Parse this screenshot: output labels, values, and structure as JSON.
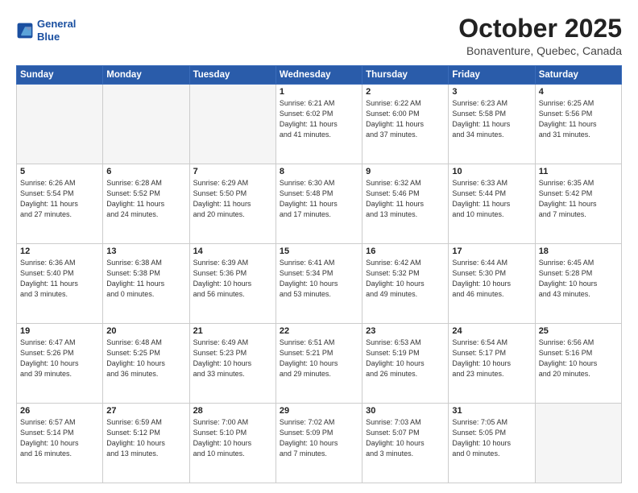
{
  "header": {
    "logo_line1": "General",
    "logo_line2": "Blue",
    "month_title": "October 2025",
    "location": "Bonaventure, Quebec, Canada"
  },
  "weekdays": [
    "Sunday",
    "Monday",
    "Tuesday",
    "Wednesday",
    "Thursday",
    "Friday",
    "Saturday"
  ],
  "weeks": [
    [
      {
        "day": "",
        "info": "",
        "empty": true
      },
      {
        "day": "",
        "info": "",
        "empty": true
      },
      {
        "day": "",
        "info": "",
        "empty": true
      },
      {
        "day": "1",
        "info": "Sunrise: 6:21 AM\nSunset: 6:02 PM\nDaylight: 11 hours\nand 41 minutes."
      },
      {
        "day": "2",
        "info": "Sunrise: 6:22 AM\nSunset: 6:00 PM\nDaylight: 11 hours\nand 37 minutes."
      },
      {
        "day": "3",
        "info": "Sunrise: 6:23 AM\nSunset: 5:58 PM\nDaylight: 11 hours\nand 34 minutes."
      },
      {
        "day": "4",
        "info": "Sunrise: 6:25 AM\nSunset: 5:56 PM\nDaylight: 11 hours\nand 31 minutes."
      }
    ],
    [
      {
        "day": "5",
        "info": "Sunrise: 6:26 AM\nSunset: 5:54 PM\nDaylight: 11 hours\nand 27 minutes."
      },
      {
        "day": "6",
        "info": "Sunrise: 6:28 AM\nSunset: 5:52 PM\nDaylight: 11 hours\nand 24 minutes."
      },
      {
        "day": "7",
        "info": "Sunrise: 6:29 AM\nSunset: 5:50 PM\nDaylight: 11 hours\nand 20 minutes."
      },
      {
        "day": "8",
        "info": "Sunrise: 6:30 AM\nSunset: 5:48 PM\nDaylight: 11 hours\nand 17 minutes."
      },
      {
        "day": "9",
        "info": "Sunrise: 6:32 AM\nSunset: 5:46 PM\nDaylight: 11 hours\nand 13 minutes."
      },
      {
        "day": "10",
        "info": "Sunrise: 6:33 AM\nSunset: 5:44 PM\nDaylight: 11 hours\nand 10 minutes."
      },
      {
        "day": "11",
        "info": "Sunrise: 6:35 AM\nSunset: 5:42 PM\nDaylight: 11 hours\nand 7 minutes."
      }
    ],
    [
      {
        "day": "12",
        "info": "Sunrise: 6:36 AM\nSunset: 5:40 PM\nDaylight: 11 hours\nand 3 minutes."
      },
      {
        "day": "13",
        "info": "Sunrise: 6:38 AM\nSunset: 5:38 PM\nDaylight: 11 hours\nand 0 minutes."
      },
      {
        "day": "14",
        "info": "Sunrise: 6:39 AM\nSunset: 5:36 PM\nDaylight: 10 hours\nand 56 minutes."
      },
      {
        "day": "15",
        "info": "Sunrise: 6:41 AM\nSunset: 5:34 PM\nDaylight: 10 hours\nand 53 minutes."
      },
      {
        "day": "16",
        "info": "Sunrise: 6:42 AM\nSunset: 5:32 PM\nDaylight: 10 hours\nand 49 minutes."
      },
      {
        "day": "17",
        "info": "Sunrise: 6:44 AM\nSunset: 5:30 PM\nDaylight: 10 hours\nand 46 minutes."
      },
      {
        "day": "18",
        "info": "Sunrise: 6:45 AM\nSunset: 5:28 PM\nDaylight: 10 hours\nand 43 minutes."
      }
    ],
    [
      {
        "day": "19",
        "info": "Sunrise: 6:47 AM\nSunset: 5:26 PM\nDaylight: 10 hours\nand 39 minutes."
      },
      {
        "day": "20",
        "info": "Sunrise: 6:48 AM\nSunset: 5:25 PM\nDaylight: 10 hours\nand 36 minutes."
      },
      {
        "day": "21",
        "info": "Sunrise: 6:49 AM\nSunset: 5:23 PM\nDaylight: 10 hours\nand 33 minutes."
      },
      {
        "day": "22",
        "info": "Sunrise: 6:51 AM\nSunset: 5:21 PM\nDaylight: 10 hours\nand 29 minutes."
      },
      {
        "day": "23",
        "info": "Sunrise: 6:53 AM\nSunset: 5:19 PM\nDaylight: 10 hours\nand 26 minutes."
      },
      {
        "day": "24",
        "info": "Sunrise: 6:54 AM\nSunset: 5:17 PM\nDaylight: 10 hours\nand 23 minutes."
      },
      {
        "day": "25",
        "info": "Sunrise: 6:56 AM\nSunset: 5:16 PM\nDaylight: 10 hours\nand 20 minutes."
      }
    ],
    [
      {
        "day": "26",
        "info": "Sunrise: 6:57 AM\nSunset: 5:14 PM\nDaylight: 10 hours\nand 16 minutes."
      },
      {
        "day": "27",
        "info": "Sunrise: 6:59 AM\nSunset: 5:12 PM\nDaylight: 10 hours\nand 13 minutes."
      },
      {
        "day": "28",
        "info": "Sunrise: 7:00 AM\nSunset: 5:10 PM\nDaylight: 10 hours\nand 10 minutes."
      },
      {
        "day": "29",
        "info": "Sunrise: 7:02 AM\nSunset: 5:09 PM\nDaylight: 10 hours\nand 7 minutes."
      },
      {
        "day": "30",
        "info": "Sunrise: 7:03 AM\nSunset: 5:07 PM\nDaylight: 10 hours\nand 3 minutes."
      },
      {
        "day": "31",
        "info": "Sunrise: 7:05 AM\nSunset: 5:05 PM\nDaylight: 10 hours\nand 0 minutes."
      },
      {
        "day": "",
        "info": "",
        "empty": true
      }
    ]
  ]
}
